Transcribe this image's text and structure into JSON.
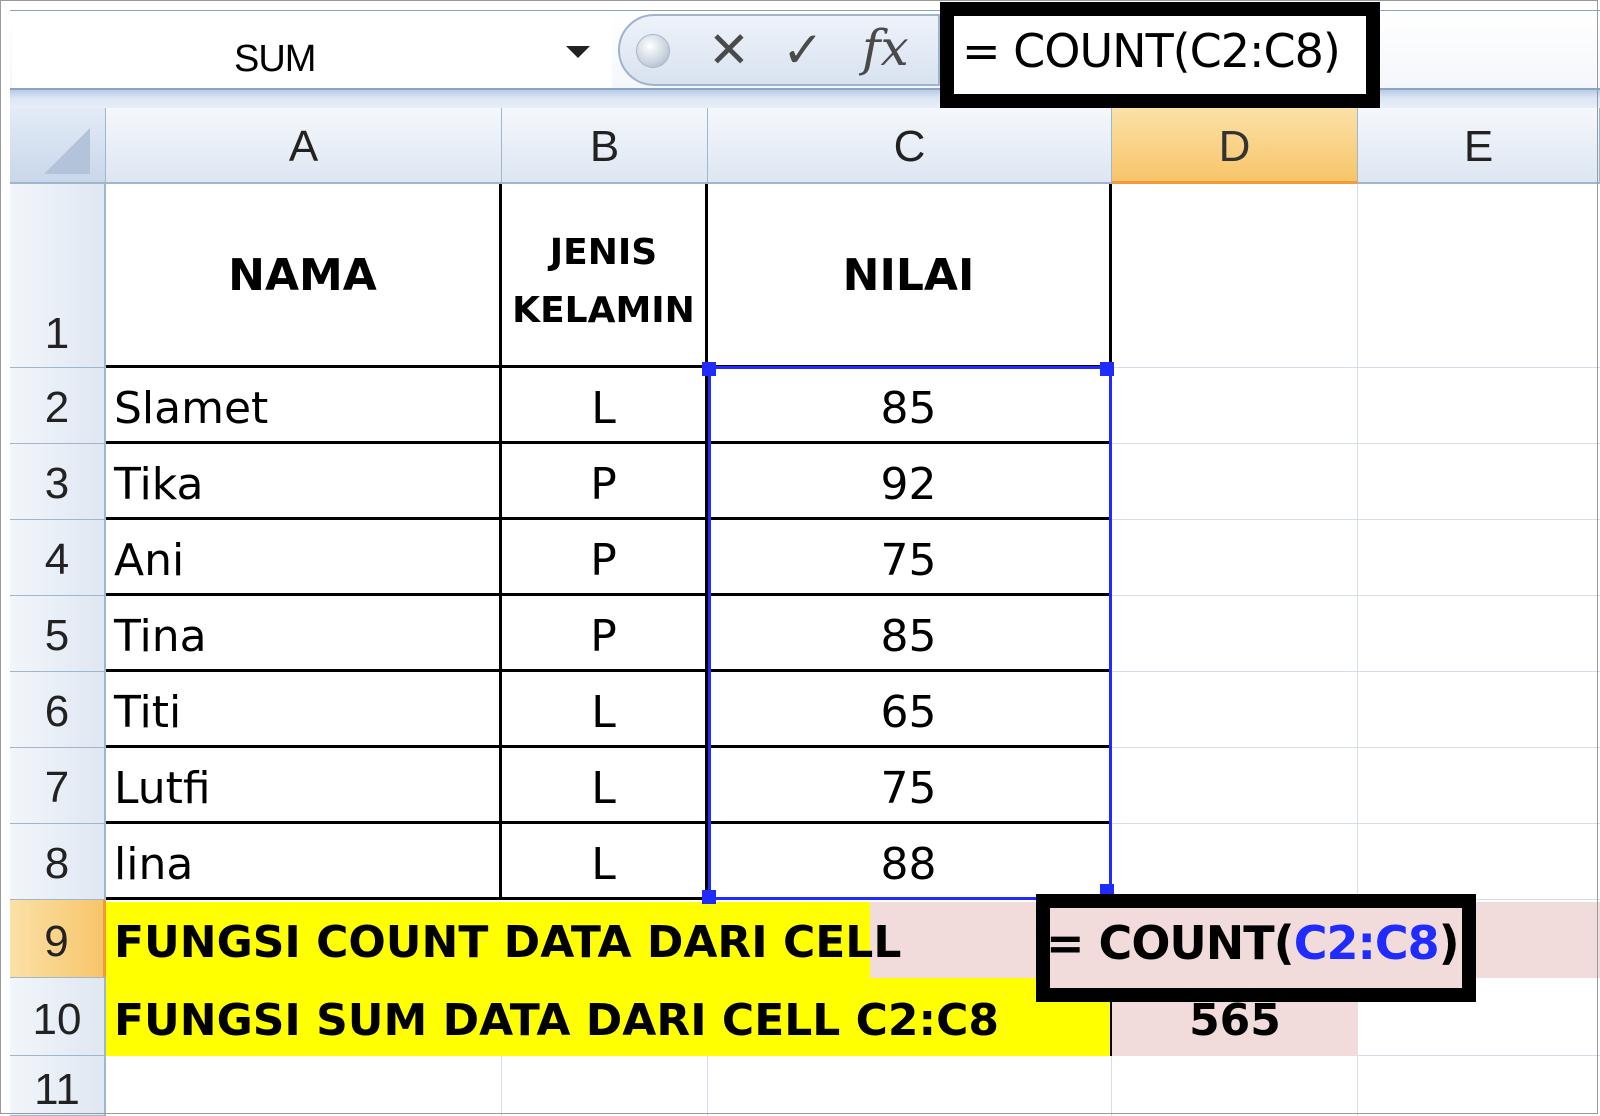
{
  "formula_bar": {
    "name_box": "SUM",
    "cancel_glyph": "✕",
    "enter_glyph": "✓",
    "function_glyph": "fx",
    "formula": "= COUNT(C2:C8)"
  },
  "columns": [
    "A",
    "B",
    "C",
    "D",
    "E"
  ],
  "active_column": "D",
  "rows": [
    "1",
    "2",
    "3",
    "4",
    "5",
    "6",
    "7",
    "8",
    "9",
    "10",
    "11"
  ],
  "active_row": "9",
  "table": {
    "headers": {
      "nama": "NAMA",
      "jenis_line1": "JENIS",
      "jenis_line2": "KELAMIN",
      "nilai": "NILAI"
    },
    "records": [
      {
        "nama": "Slamet",
        "jenis": "L",
        "nilai": "85"
      },
      {
        "nama": "Tika",
        "jenis": "P",
        "nilai": "92"
      },
      {
        "nama": "Ani",
        "jenis": "P",
        "nilai": "75"
      },
      {
        "nama": "Tina",
        "jenis": "P",
        "nilai": "85"
      },
      {
        "nama": "Titi",
        "jenis": "L",
        "nilai": "65"
      },
      {
        "nama": "Lutfi",
        "jenis": "L",
        "nilai": "75"
      },
      {
        "nama": "lina",
        "jenis": "L",
        "nilai": "88"
      }
    ]
  },
  "summary": {
    "count_label": "FUNGSI COUNT DATA DARI CELL",
    "count_formula_prefix": "= COUNT(",
    "count_formula_ref": "C2:C8",
    "count_formula_suffix": ")",
    "sum_label": "FUNGSI SUM DATA DARI CELL C2:C8",
    "sum_value": "565"
  },
  "colors": {
    "highlight_label": "#ffff00",
    "result_cell": "#f2dcdb",
    "range_reference": "#1f2bff",
    "active_header": "#f7c56a"
  }
}
